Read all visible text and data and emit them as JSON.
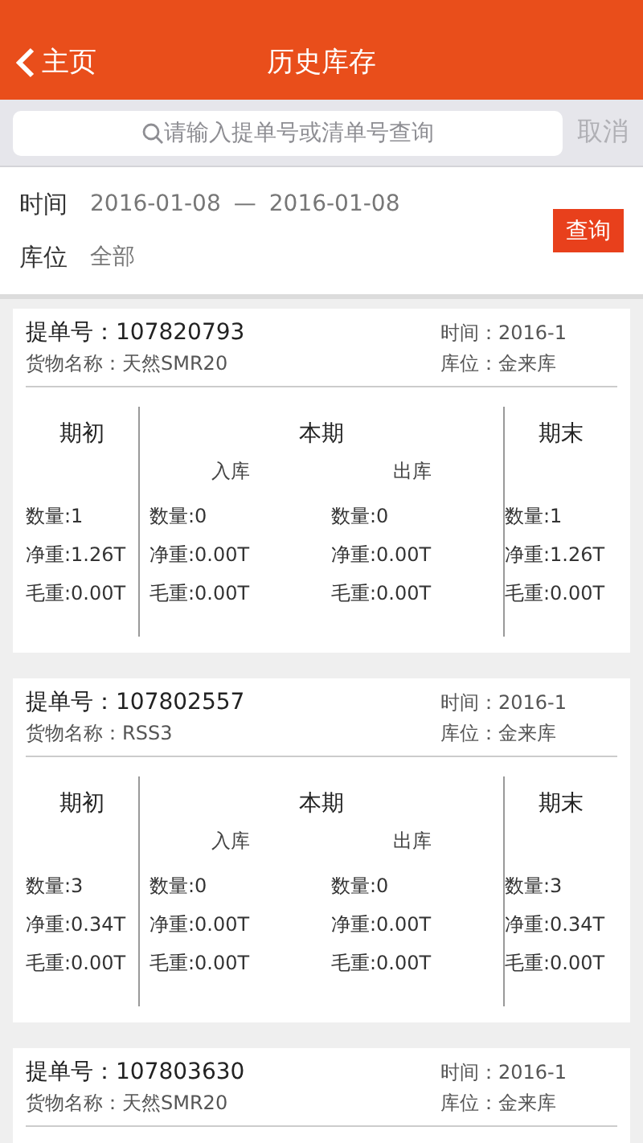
{
  "nav": {
    "back": "主页",
    "title": "历史库存"
  },
  "search": {
    "placeholder": "请输入提单号或清单号查询",
    "cancel": "取消"
  },
  "filter": {
    "time_label": "时间",
    "date_from": "2016-01-08",
    "dash": "—",
    "date_to": "2016-01-08",
    "location_label": "库位",
    "location_value": "全部",
    "query": "查询"
  },
  "cards": [
    {
      "bill_label": "提单号：",
      "bill": "107820793",
      "goods": "货物名称：天然SMR20",
      "time": "时间：2016-1",
      "location": "库位：金来库",
      "table": {
        "opening": {
          "title": "期初",
          "stats": [
            "数量:1",
            "净重:1.26T",
            "毛重:0.00T"
          ]
        },
        "current": {
          "title": "本期",
          "in": {
            "title": "入库",
            "stats": [
              "数量:0",
              "净重:0.00T",
              "毛重:0.00T"
            ]
          },
          "out": {
            "title": "出库",
            "stats": [
              "数量:0",
              "净重:0.00T",
              "毛重:0.00T"
            ]
          }
        },
        "closing": {
          "title": "期末",
          "stats": [
            "数量:1",
            "净重:1.26T",
            "毛重:0.00T"
          ]
        }
      }
    },
    {
      "bill_label": "提单号：",
      "bill": "107802557",
      "goods": "货物名称：RSS3",
      "time": "时间：2016-1",
      "location": "库位：金来库",
      "table": {
        "opening": {
          "title": "期初",
          "stats": [
            "数量:3",
            "净重:0.34T",
            "毛重:0.00T"
          ]
        },
        "current": {
          "title": "本期",
          "in": {
            "title": "入库",
            "stats": [
              "数量:0",
              "净重:0.00T",
              "毛重:0.00T"
            ]
          },
          "out": {
            "title": "出库",
            "stats": [
              "数量:0",
              "净重:0.00T",
              "毛重:0.00T"
            ]
          }
        },
        "closing": {
          "title": "期末",
          "stats": [
            "数量:3",
            "净重:0.34T",
            "毛重:0.00T"
          ]
        }
      }
    },
    {
      "bill_label": "提单号：",
      "bill": "107803630",
      "goods": "货物名称：天然SMR20",
      "time": "时间：2016-1",
      "location": "库位：金来库"
    }
  ]
}
